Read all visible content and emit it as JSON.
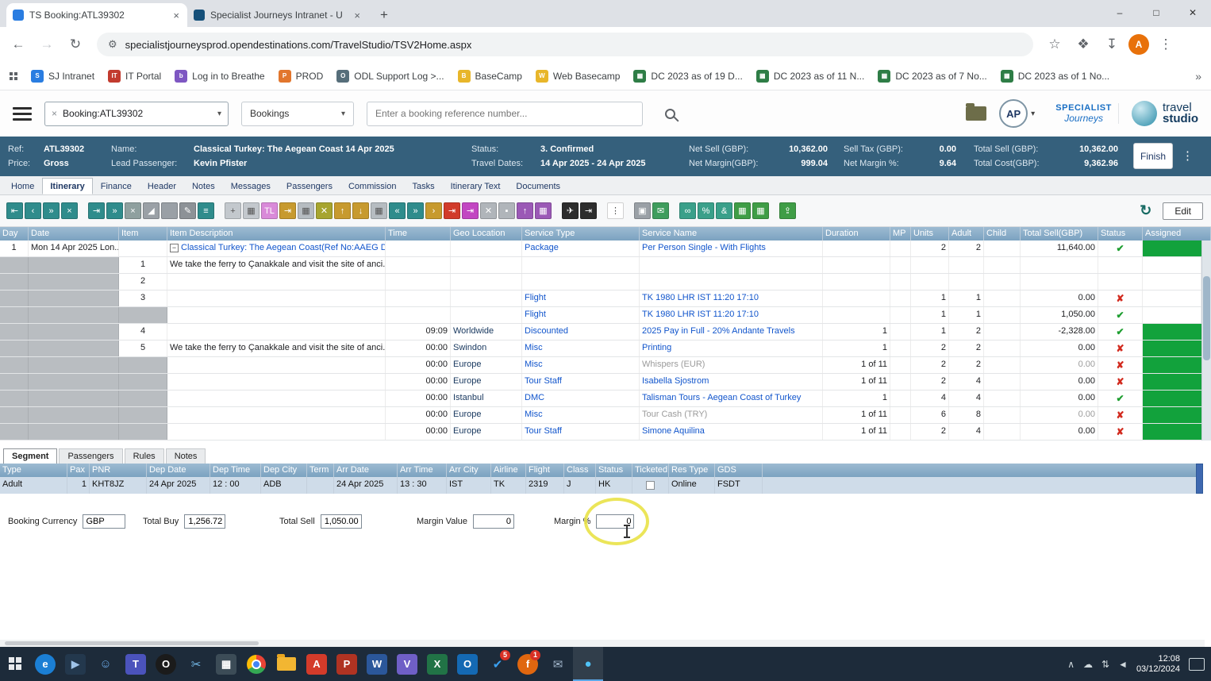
{
  "icons": {
    "back": "←",
    "forward": "→",
    "reload": "↻",
    "tune": "⚙",
    "star": "☆",
    "extensions": "❖",
    "download": "↧",
    "menu": "⋮",
    "caret": "▾",
    "clear": "×",
    "dots": "⋮",
    "overflow": "»",
    "new_tab": "+",
    "collapse": "−",
    "check": "✔",
    "cross": "✘",
    "minimize": "–",
    "maximize": "□",
    "close": "✕",
    "tab_close": "×"
  },
  "browser": {
    "tabs": [
      {
        "title": "TS Booking:ATL39302",
        "active": true,
        "favicon": "#2a7de1"
      },
      {
        "title": "Specialist Journeys Intranet - U",
        "active": false,
        "favicon": "#15507a"
      }
    ],
    "url": "specialistjourneysprod.opendestinations.com/TravelStudio/TSV2Home.aspx",
    "bookmarks": [
      {
        "label": "SJ Intranet",
        "color": "#2a7de1",
        "glyph": "S"
      },
      {
        "label": "IT Portal",
        "color": "#c23b2e",
        "glyph": "IT"
      },
      {
        "label": "Log in to Breathe",
        "color": "#7e57c2",
        "glyph": "b"
      },
      {
        "label": "PROD",
        "color": "#e2762d",
        "glyph": "P"
      },
      {
        "label": "ODL Support Log >...",
        "color": "#566e7a",
        "glyph": "O"
      },
      {
        "label": "BaseCamp",
        "color": "#e8b62a",
        "glyph": "B"
      },
      {
        "label": "Web Basecamp",
        "color": "#e8b62a",
        "glyph": "W"
      },
      {
        "label": "DC 2023 as of 19 D...",
        "color": "#2e7d46",
        "glyph": "▦"
      },
      {
        "label": "DC 2023 as of 11 N...",
        "color": "#2e7d46",
        "glyph": "▦"
      },
      {
        "label": "DC 2023 as of 7 No...",
        "color": "#2e7d46",
        "glyph": "▦"
      },
      {
        "label": "DC 2023 as of 1 No...",
        "color": "#2e7d46",
        "glyph": "▦"
      }
    ],
    "avatar_initial": "A"
  },
  "app_header": {
    "search_value": "Booking:ATL39302",
    "category": "Bookings",
    "placeholder": "Enter a booking reference number...",
    "user_initials": "AP",
    "brand_primary": "SPECIALIST",
    "brand_secondary": "Journeys",
    "logo_line1": "travel",
    "logo_line2": "studio"
  },
  "booking": {
    "ref_label": "Ref:",
    "ref": "ATL39302",
    "price_label": "Price:",
    "price": "Gross",
    "name_label": "Name:",
    "name": "Classical Turkey: The Aegean Coast 14 Apr 2025",
    "lead_label": "Lead Passenger:",
    "lead": "Kevin Pfister",
    "status_label": "Status:",
    "status": "3. Confirmed",
    "dates_label": "Travel Dates:",
    "dates": "14 Apr 2025 - 24 Apr 2025",
    "net_sell_label": "Net Sell (GBP):",
    "net_sell": "10,362.00",
    "net_margin_label": "Net Margin(GBP):",
    "net_margin": "999.04",
    "sell_tax_label": "Sell Tax (GBP):",
    "sell_tax": "0.00",
    "net_margin_pct_label": "Net Margin %:",
    "net_margin_pct": "9.64",
    "total_sell_label": "Total Sell (GBP):",
    "total_sell": "10,362.00",
    "total_cost_label": "Total Cost(GBP):",
    "total_cost": "9,362.96",
    "finish_label": "Finish"
  },
  "nav_tabs": [
    {
      "label": "Home"
    },
    {
      "label": "Itinerary",
      "active": true
    },
    {
      "label": "Finance"
    },
    {
      "label": "Header"
    },
    {
      "label": "Notes"
    },
    {
      "label": "Messages"
    },
    {
      "label": "Passengers"
    },
    {
      "label": "Commission"
    },
    {
      "label": "Tasks"
    },
    {
      "label": "Itinerary Text"
    },
    {
      "label": "Documents"
    }
  ],
  "toolbar": {
    "edit_label": "Edit",
    "groups": [
      [
        {
          "name": "nav-first",
          "glyph": "⇤",
          "bg": "#2f8c8c"
        },
        {
          "name": "nav-prev",
          "glyph": "‹",
          "bg": "#2f8c8c"
        },
        {
          "name": "nav-next-fast",
          "glyph": "»",
          "bg": "#2f8c8c"
        },
        {
          "name": "cancel",
          "glyph": "×",
          "bg": "#2f8c8c"
        }
      ],
      [
        {
          "name": "jump-end",
          "glyph": "⇥",
          "bg": "#2f8c8c"
        },
        {
          "name": "forward-fast",
          "glyph": "»",
          "bg": "#2f8c8c"
        },
        {
          "name": "delete-item",
          "glyph": "×",
          "bg": "#8fa09f"
        },
        {
          "name": "resize-handle",
          "glyph": "◢",
          "bg": "#9aa0a6"
        },
        {
          "name": "placeholder",
          "glyph": "",
          "bg": "#9aa0a6"
        },
        {
          "name": "edit-pencil",
          "glyph": "✎",
          "bg": "#8d9297"
        },
        {
          "name": "list-view",
          "glyph": "≡",
          "bg": "#2f8c8c"
        }
      ],
      [
        {
          "name": "add-item",
          "glyph": "+",
          "bg": "#c3c8cd",
          "fg": "#555555"
        },
        {
          "name": "grid-view",
          "glyph": "▦",
          "bg": "#c3c8cd",
          "fg": "#555555"
        },
        {
          "name": "timeline",
          "glyph": "TL",
          "bg": "#d98ad9"
        },
        {
          "name": "move-item",
          "glyph": "⇥",
          "bg": "#c79a2e"
        },
        {
          "name": "block-view",
          "glyph": "▦",
          "bg": "#b6bcc1",
          "fg": "#555555"
        },
        {
          "name": "strike",
          "glyph": "✕",
          "bg": "#a7a52f"
        },
        {
          "name": "move-up",
          "glyph": "↑",
          "bg": "#c79a2e"
        },
        {
          "name": "move-down",
          "glyph": "↓",
          "bg": "#c79a2e"
        },
        {
          "name": "block-2",
          "glyph": "▦",
          "bg": "#b6bcc1",
          "fg": "#555555"
        },
        {
          "name": "collapse-all",
          "glyph": "«",
          "bg": "#2f8c8c"
        },
        {
          "name": "expand-all",
          "glyph": "»",
          "bg": "#2f8c8c"
        },
        {
          "name": "advance",
          "glyph": "›",
          "bg": "#c79a2e"
        },
        {
          "name": "run-red",
          "glyph": "⇥",
          "bg": "#d13b2a"
        },
        {
          "name": "run-purple",
          "glyph": "⇥",
          "bg": "#c246c2"
        },
        {
          "name": "clear-x",
          "glyph": "✕",
          "bg": "#b0b5ba"
        },
        {
          "name": "box",
          "glyph": "▪",
          "bg": "#b0b5ba"
        },
        {
          "name": "up-purple",
          "glyph": "↑",
          "bg": "#9b59b6"
        },
        {
          "name": "grid-purple",
          "glyph": "▦",
          "bg": "#9b59b6"
        }
      ],
      [
        {
          "name": "flight-tool",
          "glyph": "✈",
          "bg": "#2d2d2d"
        },
        {
          "name": "flight-end",
          "glyph": "⇥",
          "bg": "#2d2d2d"
        }
      ],
      [
        {
          "name": "more-menu",
          "glyph": "⋮",
          "bg": "#ffffff",
          "fg": "#444444"
        }
      ],
      [
        {
          "name": "snapshot",
          "glyph": "▣",
          "bg": "#9aa0a6"
        },
        {
          "name": "email",
          "glyph": "✉",
          "bg": "#3f9d5d"
        }
      ],
      [
        {
          "name": "linked-items",
          "glyph": "∞",
          "bg": "#3aa08a"
        },
        {
          "name": "percent",
          "glyph": "%",
          "bg": "#3aa08a"
        },
        {
          "name": "link",
          "glyph": "&",
          "bg": "#3aa08a"
        },
        {
          "name": "sheet-1",
          "glyph": "▦",
          "bg": "#3f9d46"
        },
        {
          "name": "sheet-2",
          "glyph": "▦",
          "bg": "#3f9d46"
        }
      ],
      [
        {
          "name": "export",
          "glyph": "⇪",
          "bg": "#3f9d46"
        }
      ]
    ]
  },
  "itinerary": {
    "columns": [
      "Day",
      "Date",
      "Item",
      "Item Description",
      "Time",
      "Geo Location",
      "Service Type",
      "Service Name",
      "Duration",
      "MP",
      "Units",
      "Adult",
      "Child",
      "Total Sell(GBP)",
      "Status",
      "Assigned"
    ],
    "rows": [
      {
        "day": "1",
        "date": "Mon 14 Apr 2025 Lon...",
        "desc": "Classical Turkey: The Aegean Coast(Ref No:AAEG De",
        "desc_link": true,
        "collapser": true,
        "stype": "Package",
        "sname": "Per Person Single - With Flights",
        "units": "2",
        "adult": "2",
        "total": "11,640.00",
        "status": "check",
        "assigned": true,
        "first": true
      },
      {
        "item": "1",
        "desc": "We take the ferry to Çanakkale and visit the site of anci..."
      },
      {
        "item": "2"
      },
      {
        "item": "3",
        "stype": "Flight",
        "sname": "TK 1980 LHR IST 11:20 17:10",
        "units": "1",
        "adult": "1",
        "total": "0.00",
        "status": "cross"
      },
      {
        "stype": "Flight",
        "sname": "TK 1980 LHR IST 11:20 17:10",
        "units": "1",
        "adult": "1",
        "total": "1,050.00",
        "status": "check"
      },
      {
        "item": "4",
        "time": "09:09",
        "geo": "Worldwide",
        "stype": "Discounted",
        "sname": "2025 Pay in Full - 20% Andante Travels",
        "dur": "1",
        "units": "1",
        "adult": "2",
        "total": "-2,328.00",
        "status": "check",
        "assigned": true
      },
      {
        "item": "5",
        "desc": "We take the ferry to Çanakkale and visit the site of anci...",
        "time": "00:00",
        "geo": "Swindon",
        "stype": "Misc",
        "sname": "Printing",
        "dur": "1",
        "units": "2",
        "adult": "2",
        "total": "0.00",
        "status": "cross",
        "assigned": true
      },
      {
        "time": "00:00",
        "geo": "Europe",
        "stype": "Misc",
        "sname": "Whispers (EUR)",
        "muted": true,
        "dur": "1 of 11",
        "units": "2",
        "adult": "2",
        "total": "0.00",
        "status": "cross",
        "assigned": true
      },
      {
        "time": "00:00",
        "geo": "Europe",
        "stype": "Tour Staff",
        "sname": "Isabella Sjostrom",
        "dur": "1 of 11",
        "units": "2",
        "adult": "4",
        "total": "0.00",
        "status": "cross",
        "assigned": true
      },
      {
        "time": "00:00",
        "geo": "Istanbul",
        "stype": "DMC",
        "sname": "Talisman Tours - Aegean Coast of Turkey",
        "dur": "1",
        "units": "4",
        "adult": "4",
        "total": "0.00",
        "status": "check",
        "assigned": true
      },
      {
        "time": "00:00",
        "geo": "Europe",
        "stype": "Misc",
        "sname": "Tour Cash (TRY)",
        "muted": true,
        "dur": "1 of 11",
        "units": "6",
        "adult": "8",
        "total": "0.00",
        "status": "cross",
        "assigned": true
      },
      {
        "time": "00:00",
        "geo": "Europe",
        "stype": "Tour Staff",
        "sname": "Simone Aquilina",
        "dur": "1 of 11",
        "units": "2",
        "adult": "4",
        "total": "0.00",
        "status": "cross",
        "assigned": true
      }
    ]
  },
  "segment": {
    "tabs": [
      {
        "label": "Segment",
        "active": true
      },
      {
        "label": "Passengers"
      },
      {
        "label": "Rules"
      },
      {
        "label": "Notes"
      }
    ],
    "columns": [
      "Type",
      "Pax",
      "PNR",
      "Dep Date",
      "Dep Time",
      "Dep City",
      "Term",
      "Arr Date",
      "Arr Time",
      "Arr City",
      "Airline",
      "Flight",
      "Class",
      "Status",
      "Ticketed",
      "Res Type",
      "GDS"
    ],
    "row": {
      "type": "Adult",
      "pax": "1",
      "pnr": "KHT8JZ",
      "dep_date": "24 Apr 2025",
      "dep_time": "12 : 00",
      "dep_city": "ADB",
      "term": "",
      "arr_date": "24 Apr 2025",
      "arr_time": "13 : 30",
      "arr_city": "IST",
      "airline": "TK",
      "flight": "2319",
      "class": "J",
      "status": "HK",
      "ticketed": false,
      "res_type": "Online",
      "gds": "FSDT"
    },
    "summary": {
      "currency_label": "Booking Currency",
      "currency": "GBP",
      "total_buy_label": "Total Buy",
      "total_buy": "1,256.72",
      "total_sell_label": "Total Sell",
      "total_sell": "1,050.00",
      "margin_value_label": "Margin Value",
      "margin_value": "0",
      "margin_pct_label": "Margin %",
      "margin_pct": "0"
    }
  },
  "taskbar": {
    "icons": [
      {
        "name": "start",
        "special": "windows"
      },
      {
        "name": "edge",
        "glyph": "e",
        "bg": "#1b7fd4",
        "round": true
      },
      {
        "name": "media-player",
        "glyph": "▶",
        "bg": "#23384d",
        "fg": "#9fc3e8"
      },
      {
        "name": "people",
        "glyph": "☺",
        "fg": "#6aa9e8"
      },
      {
        "name": "teams",
        "glyph": "T",
        "bg": "#4b53bc"
      },
      {
        "name": "opera",
        "glyph": "O",
        "bg": "#1b1b1b",
        "round": true
      },
      {
        "name": "snipping-tool",
        "glyph": "✂",
        "fg": "#74b9e8"
      },
      {
        "name": "calculator",
        "glyph": "▦",
        "bg": "#3c4c57"
      },
      {
        "name": "chrome",
        "special": "chrome"
      },
      {
        "name": "file-explorer",
        "special": "folder"
      },
      {
        "name": "acrobat",
        "glyph": "A",
        "bg": "#d43b2a"
      },
      {
        "name": "publisher",
        "glyph": "P",
        "bg": "#b03322"
      },
      {
        "name": "word",
        "glyph": "W",
        "bg": "#2b579a"
      },
      {
        "name": "visio",
        "glyph": "V",
        "bg": "#6f5fc6"
      },
      {
        "name": "excel",
        "glyph": "X",
        "bg": "#217346"
      },
      {
        "name": "outlook",
        "glyph": "O",
        "bg": "#1469b3"
      },
      {
        "name": "defender-check",
        "glyph": "✔",
        "fg": "#3aa0f0",
        "badge": "5"
      },
      {
        "name": "firefox",
        "glyph": "f",
        "bg": "#e0670f",
        "round": true,
        "badge": "1"
      },
      {
        "name": "mail",
        "glyph": "✉",
        "fg": "#9fb3c8"
      },
      {
        "name": "camera-app",
        "glyph": "●",
        "fg": "#4fc3f7",
        "active": true
      }
    ],
    "tray": {
      "icons": [
        {
          "name": "hidden-icons-chevron",
          "glyph": "∧"
        },
        {
          "name": "onedrive-tray-icon",
          "glyph": "☁"
        },
        {
          "name": "network-icon",
          "glyph": "⇅"
        },
        {
          "name": "volume-icon",
          "glyph": "◄"
        }
      ],
      "time": "12:08",
      "date": "03/12/2024"
    }
  }
}
